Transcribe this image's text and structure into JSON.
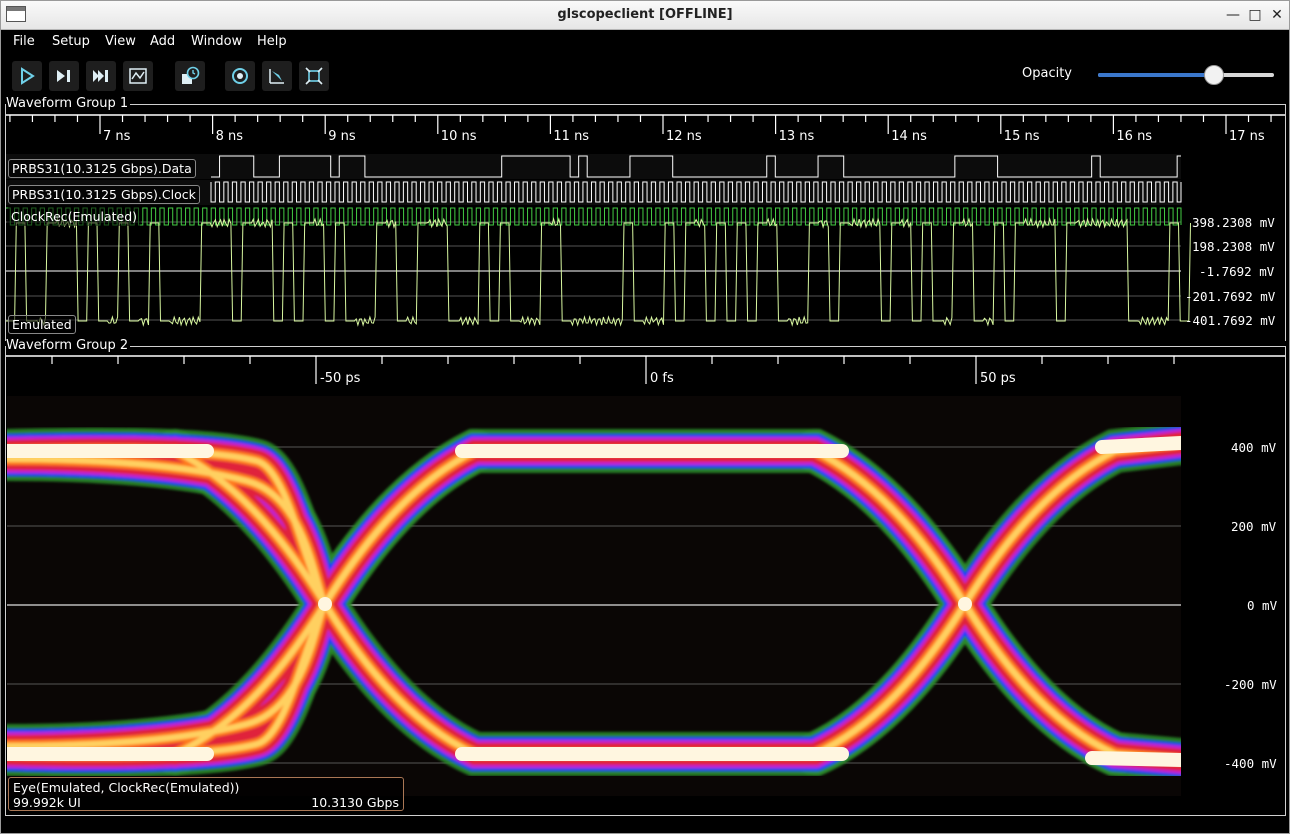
{
  "window": {
    "title": "glscopeclient [OFFLINE]"
  },
  "menu": [
    "File",
    "Setup",
    "View",
    "Add",
    "Window",
    "Help"
  ],
  "toolbar": {
    "buttons": [
      "start-trigger-icon",
      "single-trigger-icon",
      "force-trigger-icon",
      "stop-trigger-icon",
      "history-icon",
      "refresh-icon",
      "fullscreen-icon",
      "zoom-fit-icon"
    ],
    "opacity_label": "Opacity",
    "opacity_value": 0.66,
    "accent": "#3a77cc"
  },
  "group1": {
    "title": "Waveform Group 1",
    "time_ticks": [
      "7 ns",
      "8 ns",
      "9 ns",
      "10 ns",
      "11 ns",
      "12 ns",
      "13 ns",
      "14 ns",
      "15 ns",
      "16 ns",
      "17 ns"
    ],
    "channels": {
      "data": "PRBS31(10.3125 Gbps).Data",
      "clock": "PRBS31(10.3125 Gbps).Clock",
      "clockrec": "ClockRec(Emulated)",
      "analog": "Emulated"
    },
    "voltage_labels": [
      "398.2308 mV",
      "198.2308 mV",
      "-1.7692 mV",
      "-201.7692 mV",
      "-401.7692 mV"
    ],
    "trace_color": "#d8f7a0",
    "clockrec_color": "#44cc44"
  },
  "group2": {
    "title": "Waveform Group 2",
    "time_ticks": [
      "-50 ps",
      "0 fs",
      "50 ps"
    ],
    "voltage_labels": [
      "400 mV",
      "200 mV",
      "0 mV",
      "-200 mV",
      "-400 mV"
    ],
    "eye": {
      "name": "Eye(Emulated, ClockRec(Emulated))",
      "ui_count": "99.992k UI",
      "rate": "10.3130 Gbps"
    }
  }
}
